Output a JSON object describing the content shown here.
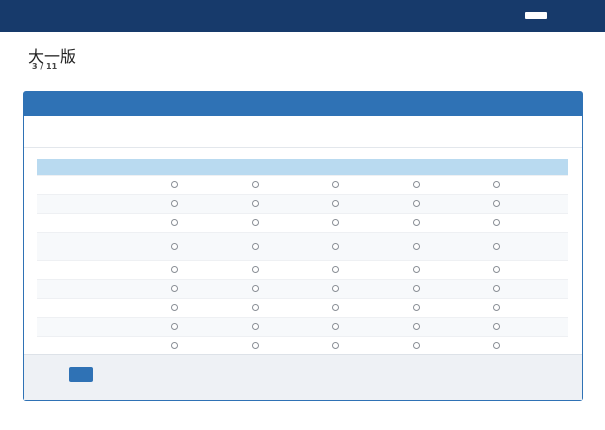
{
  "topbar": {
    "brand": "",
    "user_label": "",
    "logout": ""
  },
  "page": {
    "title": "大一版",
    "progress_label": "",
    "progress_value": "3 / 11"
  },
  "panel": {
    "title": "",
    "instruction": ""
  },
  "table": {
    "corner_header": "",
    "columns": [
      "",
      "",
      "",
      "",
      ""
    ],
    "rows": [
      {
        "label": ""
      },
      {
        "label": ""
      },
      {
        "label": ""
      },
      {
        "label": ""
      },
      {
        "label": ""
      },
      {
        "label": ""
      },
      {
        "label": ""
      },
      {
        "label": ""
      },
      {
        "label": ""
      }
    ]
  },
  "actions": {
    "next_label": ""
  },
  "footer": {
    "copyright": ""
  },
  "colors": {
    "topbar": "#173a6b",
    "panel_header": "#2f72b5",
    "table_header": "#b9daf0",
    "button": "#2f72b5"
  },
  "icons": {
    "user": "user-name-block",
    "radio": "radio-circle-icon"
  }
}
